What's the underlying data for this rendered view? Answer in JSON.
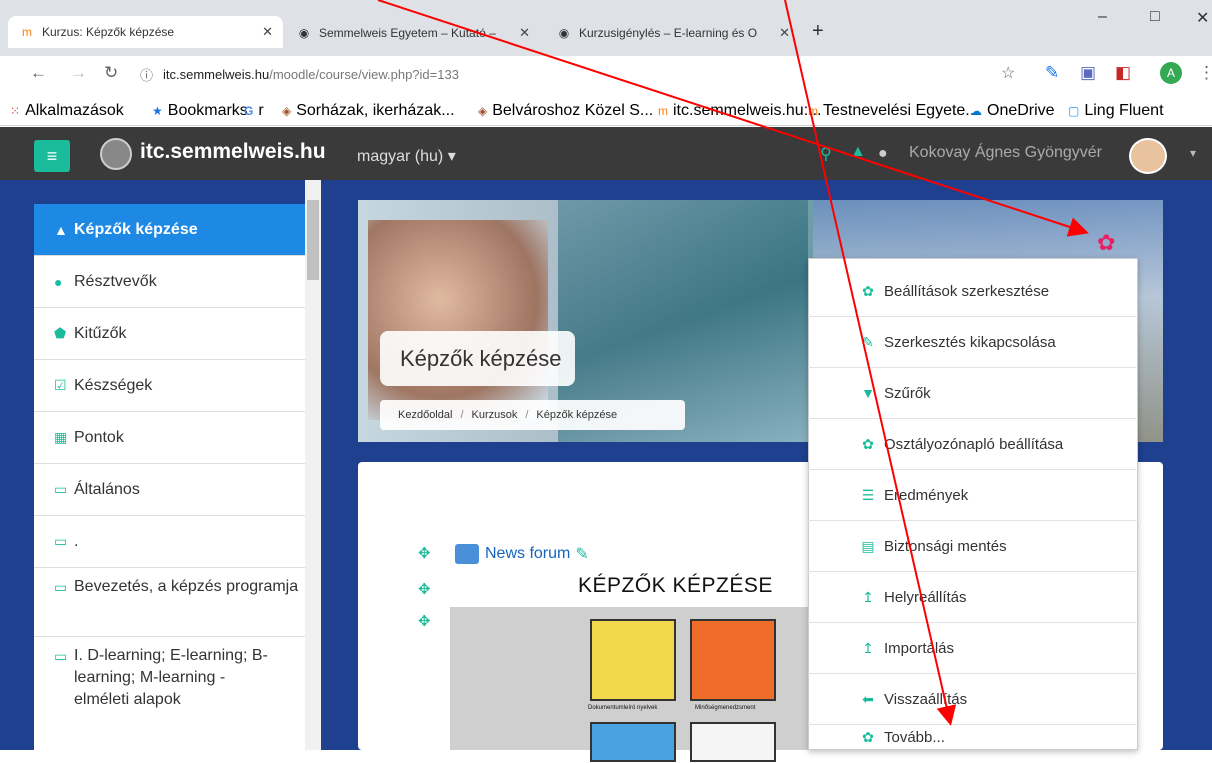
{
  "browser": {
    "tabs": [
      {
        "title": "Kurzus: Képzők képzése",
        "icon": "moodle-icon"
      },
      {
        "title": "Semmelweis Egyetem – Kutató –",
        "icon": "seal-icon"
      },
      {
        "title": "Kurzusigénylés – E-learning és O",
        "icon": "seal-icon"
      }
    ],
    "new_tab": "+",
    "window_controls": {
      "minimize": "–",
      "maximize": "□",
      "close": "✕"
    },
    "url_host": "itc.semmelweis.hu",
    "url_path": "/moodle/course/view.php?id=133",
    "bookmarks": [
      {
        "label": "Alkalmazások",
        "icon": "apps-grid-icon"
      },
      {
        "label": "Bookmarks",
        "icon": "star-icon"
      },
      {
        "label": "r",
        "icon": "google-icon"
      },
      {
        "label": "Sorházak, ikerházak...",
        "icon": "cube-icon"
      },
      {
        "label": "Belvároshoz Közel S...",
        "icon": "cube-icon"
      },
      {
        "label": "itc.semmelweis.hu:...",
        "icon": "moodle-icon"
      },
      {
        "label": "Testnevelési Egyete...",
        "icon": "moodle-icon"
      },
      {
        "label": "OneDrive",
        "icon": "cloud-icon"
      },
      {
        "label": "Ling Fluent",
        "icon": "app-icon"
      }
    ]
  },
  "navbar": {
    "site_name": "itc.semmelweis.hu",
    "language": "magyar (hu) ▾",
    "user_name": "Kokovay Ágnes Gyöngyvér",
    "hamburger": "≡",
    "user_dropdown": "▾"
  },
  "sidebar": {
    "items": [
      {
        "label": "Képzők képzése",
        "icon": "graduation-cap-icon"
      },
      {
        "label": "Résztvevők",
        "icon": "users-icon"
      },
      {
        "label": "Kitűzők",
        "icon": "shield-icon"
      },
      {
        "label": "Készségek",
        "icon": "checkbox-icon"
      },
      {
        "label": "Pontok",
        "icon": "table-icon"
      },
      {
        "label": "Általános",
        "icon": "folder-icon"
      },
      {
        "label": ".",
        "icon": "folder-icon"
      },
      {
        "label": "Bevezetés, a képzés programja",
        "icon": "folder-icon"
      },
      {
        "label": "I. D-learning; E-learning; B-learning; M-learning - elméleti alapok",
        "icon": "folder-icon"
      }
    ]
  },
  "course": {
    "title": "Képzők képzése",
    "breadcrumb": [
      "Kezdőoldal",
      "Kurzusok",
      "Képzők képzése"
    ],
    "forum_label": "News forum",
    "section_title": "KÉPZŐK KÉPZÉSE",
    "card_captions": [
      "Dokumentumleíró nyelvek",
      "Minőségmenedzsment"
    ]
  },
  "settings_menu": {
    "items": [
      {
        "label": "Beállítások szerkesztése",
        "icon": "gear-icon"
      },
      {
        "label": "Szerkesztés kikapcsolása",
        "icon": "pencil-icon"
      },
      {
        "label": "Szűrők",
        "icon": "filter-icon"
      },
      {
        "label": "Osztályozónapló beállítása",
        "icon": "gear-icon"
      },
      {
        "label": "Eredmények",
        "icon": "list-icon"
      },
      {
        "label": "Biztonsági mentés",
        "icon": "file-archive-icon"
      },
      {
        "label": "Helyreállítás",
        "icon": "upload-icon"
      },
      {
        "label": "Importálás",
        "icon": "upload-icon"
      },
      {
        "label": "Visszaállítás",
        "icon": "arrow-left-icon"
      },
      {
        "label": "Tovább...",
        "icon": "gear-icon"
      }
    ]
  },
  "colors": {
    "accent": "#1abc9c",
    "navbar": "#3a3a3a",
    "page_bg": "#1f3f8f",
    "active_item": "#1e88e5",
    "annotation_arrow": "#ff0000",
    "gear": "#e91e63"
  }
}
